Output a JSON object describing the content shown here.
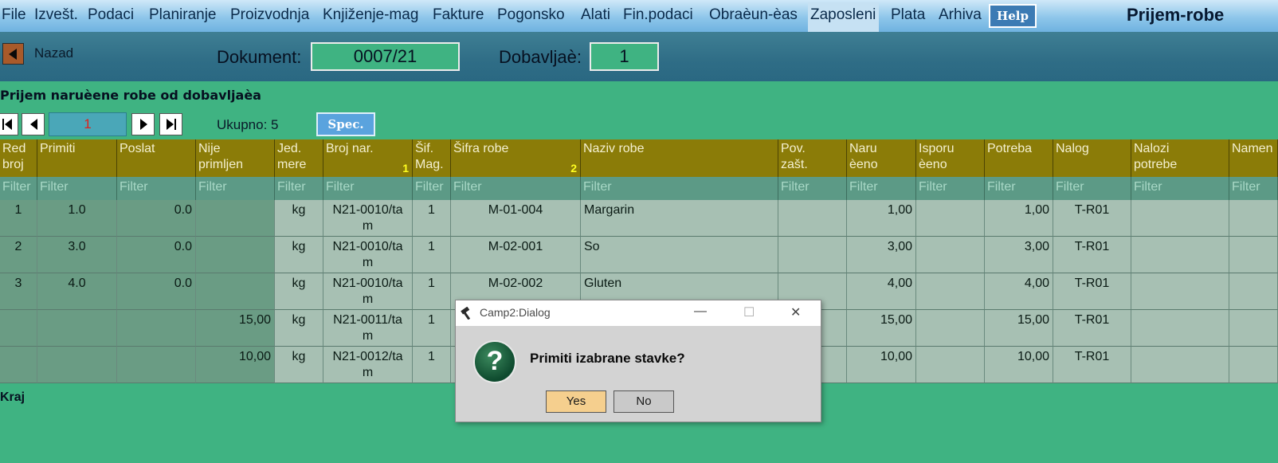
{
  "menu": {
    "items": [
      "File",
      "Izvešt.",
      "Podaci",
      "Planiranje",
      "Proizvodnja",
      "Knjiženje-mag",
      "Fakture",
      "Pogonsko",
      "Alati",
      "Fin.podaci",
      "Obraèun-èas",
      "Zaposleni",
      "Plata",
      "Arhiva"
    ],
    "help_label": "Help",
    "screen_title": "Prijem-robe"
  },
  "header": {
    "back_label": "Nazad",
    "document_label": "Dokument:",
    "document_value": "0007/21",
    "supplier_label": "Dobavljaè:",
    "supplier_value": "1"
  },
  "section": {
    "title": "Prijem naruèene robe od dobavljaèa",
    "page_value": "1",
    "total_label": "Ukupno: 5",
    "spec_label": "Spec."
  },
  "table": {
    "columns": [
      {
        "label": "Red\nbroj"
      },
      {
        "label": "Primiti"
      },
      {
        "label": "Poslat"
      },
      {
        "label": "Nije\nprimljen"
      },
      {
        "label": "Jed.\nmere"
      },
      {
        "label": "Broj nar.",
        "sort": "1"
      },
      {
        "label": "Šif.\nMag."
      },
      {
        "label": "Šifra robe",
        "sort": "2"
      },
      {
        "label": "Naziv robe"
      },
      {
        "label": "Pov.\nzašt."
      },
      {
        "label": "Naru\nèeno"
      },
      {
        "label": "Isporu\nèeno"
      },
      {
        "label": "Potreba"
      },
      {
        "label": "Nalog"
      },
      {
        "label": "Nalozi\npotrebe"
      },
      {
        "label": "Namen"
      }
    ],
    "filter_placeholder": "Filter",
    "rows": [
      [
        "1",
        "1.0",
        "0.0",
        "",
        "kg",
        "N21-0010/ta\nm",
        "1",
        "M-01-004",
        "Margarin",
        "",
        "1,00",
        "",
        "1,00",
        "T-R01",
        "",
        ""
      ],
      [
        "2",
        "3.0",
        "0.0",
        "",
        "kg",
        "N21-0010/ta\nm",
        "1",
        "M-02-001",
        "So",
        "",
        "3,00",
        "",
        "3,00",
        "T-R01",
        "",
        ""
      ],
      [
        "3",
        "4.0",
        "0.0",
        "",
        "kg",
        "N21-0010/ta\nm",
        "1",
        "M-02-002",
        "Gluten",
        "",
        "4,00",
        "",
        "4,00",
        "T-R01",
        "",
        ""
      ],
      [
        "",
        "",
        "",
        "15,00",
        "kg",
        "N21-0011/ta\nm",
        "1",
        "",
        "",
        "",
        "15,00",
        "",
        "15,00",
        "T-R01",
        "",
        ""
      ],
      [
        "",
        "",
        "",
        "10,00",
        "kg",
        "N21-0012/ta\nm",
        "1",
        "",
        "",
        "",
        "10,00",
        "",
        "10,00",
        "T-R01",
        "",
        ""
      ]
    ]
  },
  "footer": {
    "text": "Kraj"
  },
  "dialog": {
    "title": "Camp2:Dialog",
    "icon_glyph": "?",
    "message": "Primiti izabrane stavke?",
    "yes_label": "Yes",
    "no_label": "No",
    "minimize_glyph": "—",
    "maximize_glyph": "☐",
    "close_glyph": "✕"
  },
  "colors": {
    "background": "#3fb382",
    "header_strip": "#2f6d86",
    "table_header": "#8b7c08",
    "sort_number": "#ffff20",
    "page_number": "#e0221a",
    "yes_button": "#f5cf8e"
  }
}
